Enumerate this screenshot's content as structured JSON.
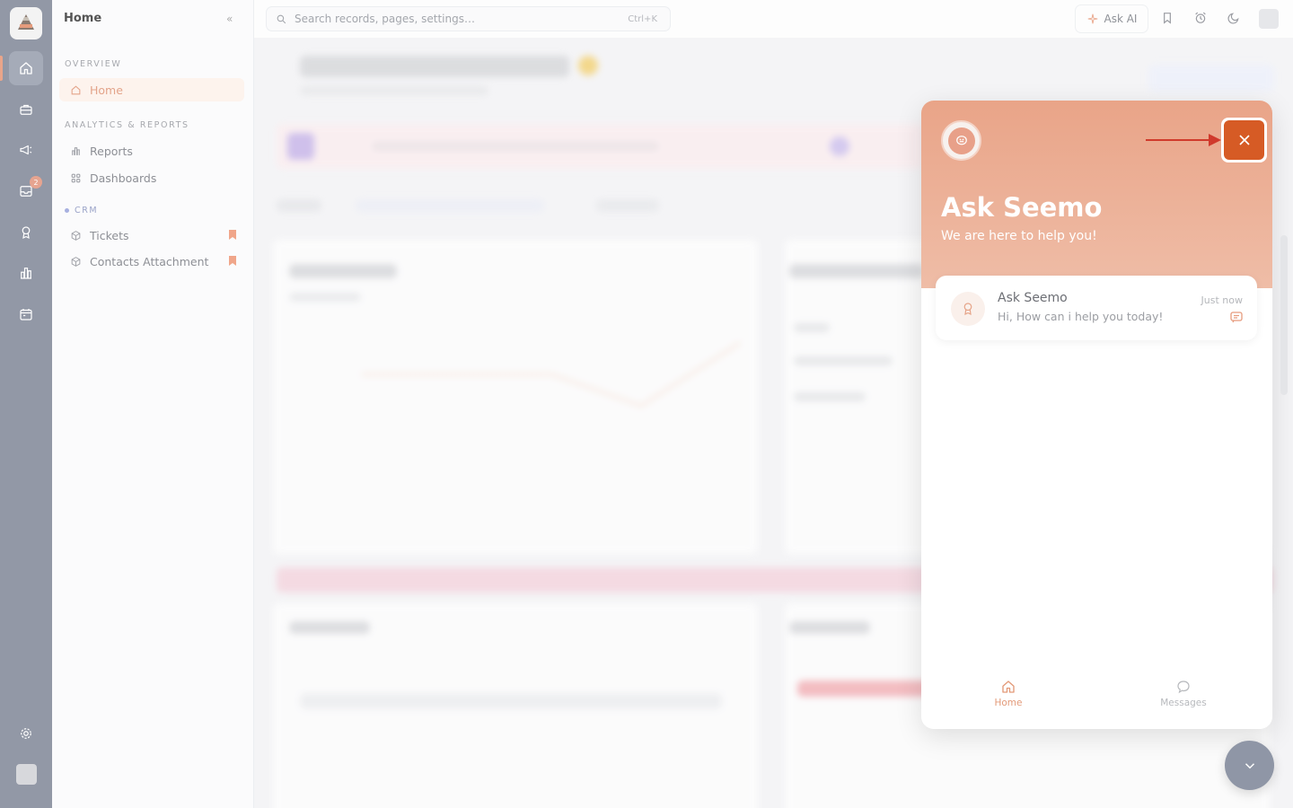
{
  "rail": {
    "badge_count": "2",
    "items": [
      "home-icon",
      "briefcase-icon",
      "megaphone-icon",
      "inbox-icon",
      "award-icon",
      "chart-icon",
      "calendar-icon"
    ],
    "bottom": [
      "gear-icon"
    ]
  },
  "sidebar": {
    "title": "Home",
    "sections": {
      "overview": "OVERVIEW",
      "analytics": "ANALYTICS & REPORTS",
      "crm": "CRM"
    },
    "items": {
      "home": "Home",
      "reports": "Reports",
      "dashboards": "Dashboards",
      "tickets": "Tickets",
      "contacts_attachment": "Contacts Attachment"
    }
  },
  "topbar": {
    "search_placeholder": "Search records, pages, settings…",
    "shortcut": "Ctrl+K",
    "ask_ai": "Ask AI"
  },
  "chat": {
    "title": "Ask Seemo",
    "subtitle": "We are here to help you!",
    "message": {
      "sender": "Ask Seemo",
      "text": "Hi, How can i help you today!",
      "time": "Just now"
    },
    "tabs": {
      "home": "Home",
      "messages": "Messages"
    }
  },
  "colors": {
    "accent": "#e9a488",
    "close_button": "#d65b25",
    "arrow": "#d03a2c",
    "rail": "#9298a6"
  }
}
